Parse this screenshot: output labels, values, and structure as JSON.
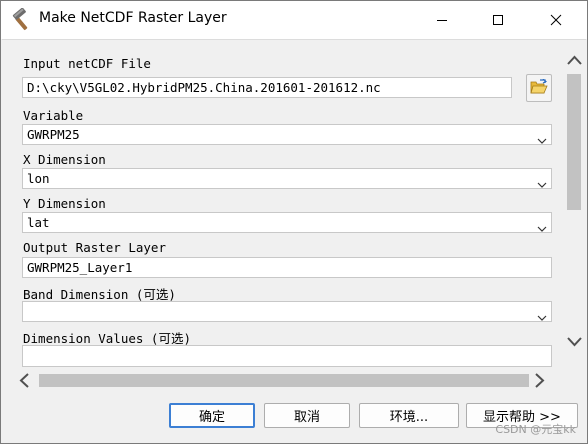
{
  "window": {
    "title": "Make NetCDF Raster Layer",
    "icon": "hammer-icon",
    "controls": [
      "minimize-icon",
      "maximize-icon",
      "close-icon"
    ]
  },
  "form": {
    "input_file": {
      "label": "Input netCDF File",
      "value": "D:\\cky\\V5GL02.HybridPM25.China.201601-201612.nc",
      "browse_icon": "folder-open-icon"
    },
    "variable": {
      "label": "Variable",
      "value": "GWRPM25"
    },
    "x_dimension": {
      "label": "X Dimension",
      "value": "lon"
    },
    "y_dimension": {
      "label": "Y Dimension",
      "value": "lat"
    },
    "output_layer": {
      "label": "Output Raster Layer",
      "value": "GWRPM25_Layer1"
    },
    "band_dimension": {
      "label": "Band Dimension (可选)",
      "value": ""
    },
    "dimension_values": {
      "label": "Dimension Values (可选)",
      "value": ""
    }
  },
  "buttons": {
    "ok": "确定",
    "cancel": "取消",
    "environments": "环境...",
    "show_help": "显示帮助 >>"
  },
  "watermark": "CSDN @元宝kk"
}
